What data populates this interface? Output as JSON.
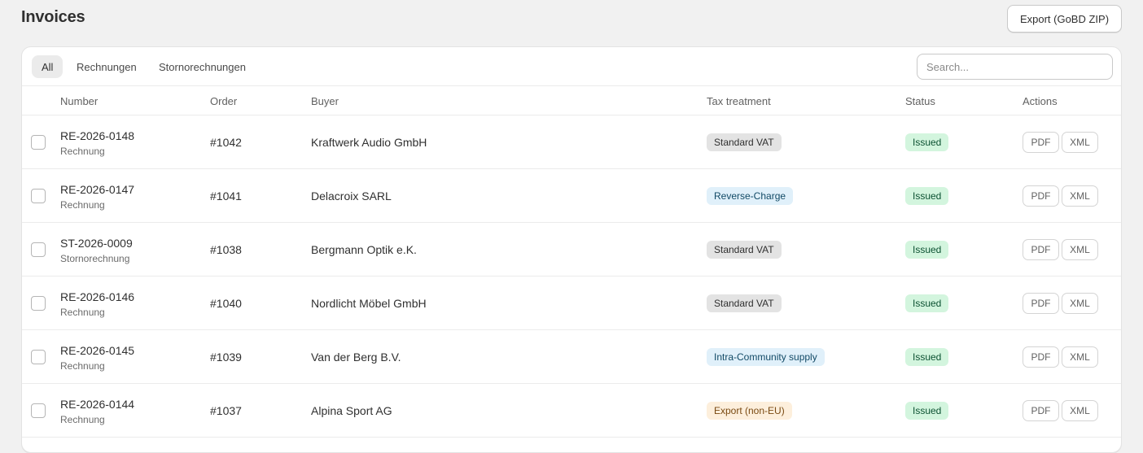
{
  "page": {
    "title": "Invoices",
    "export_label": "Export (GoBD ZIP)"
  },
  "tabs": [
    {
      "label": "All",
      "active": true
    },
    {
      "label": "Rechnungen",
      "active": false
    },
    {
      "label": "Stornorechnungen",
      "active": false
    }
  ],
  "search": {
    "placeholder": "Search...",
    "value": ""
  },
  "columns": {
    "number": "Number",
    "order": "Order",
    "buyer": "Buyer",
    "tax": "Tax treatment",
    "status": "Status",
    "actions": "Actions"
  },
  "actions": {
    "pdf": "PDF",
    "xml": "XML"
  },
  "rows": [
    {
      "number": "RE-2026-0148",
      "type": "Rechnung",
      "order": "#1042",
      "buyer": "Kraftwerk Audio GmbH",
      "tax": "Standard VAT",
      "tax_tone": "neutral",
      "status": "Issued"
    },
    {
      "number": "RE-2026-0147",
      "type": "Rechnung",
      "order": "#1041",
      "buyer": "Delacroix SARL",
      "tax": "Reverse-Charge",
      "tax_tone": "info",
      "status": "Issued"
    },
    {
      "number": "ST-2026-0009",
      "type": "Stornorechnung",
      "order": "#1038",
      "buyer": "Bergmann Optik e.K.",
      "tax": "Standard VAT",
      "tax_tone": "neutral",
      "status": "Issued"
    },
    {
      "number": "RE-2026-0146",
      "type": "Rechnung",
      "order": "#1040",
      "buyer": "Nordlicht Möbel GmbH",
      "tax": "Standard VAT",
      "tax_tone": "neutral",
      "status": "Issued"
    },
    {
      "number": "RE-2026-0145",
      "type": "Rechnung",
      "order": "#1039",
      "buyer": "Van der Berg B.V.",
      "tax": "Intra-Community supply",
      "tax_tone": "info",
      "status": "Issued"
    },
    {
      "number": "RE-2026-0144",
      "type": "Rechnung",
      "order": "#1037",
      "buyer": "Alpina Sport AG",
      "tax": "Export (non-EU)",
      "tax_tone": "warn",
      "status": "Issued"
    }
  ]
}
